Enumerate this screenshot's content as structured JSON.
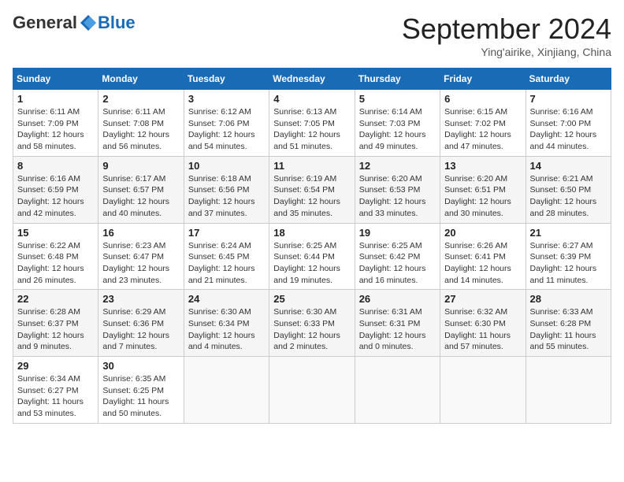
{
  "header": {
    "logo_general": "General",
    "logo_blue": "Blue",
    "month_title": "September 2024",
    "subtitle": "Ying'airike, Xinjiang, China"
  },
  "weekdays": [
    "Sunday",
    "Monday",
    "Tuesday",
    "Wednesday",
    "Thursday",
    "Friday",
    "Saturday"
  ],
  "weeks": [
    [
      {
        "day": "1",
        "sunrise": "6:11 AM",
        "sunset": "7:09 PM",
        "daylight": "12 hours and 58 minutes."
      },
      {
        "day": "2",
        "sunrise": "6:11 AM",
        "sunset": "7:08 PM",
        "daylight": "12 hours and 56 minutes."
      },
      {
        "day": "3",
        "sunrise": "6:12 AM",
        "sunset": "7:06 PM",
        "daylight": "12 hours and 54 minutes."
      },
      {
        "day": "4",
        "sunrise": "6:13 AM",
        "sunset": "7:05 PM",
        "daylight": "12 hours and 51 minutes."
      },
      {
        "day": "5",
        "sunrise": "6:14 AM",
        "sunset": "7:03 PM",
        "daylight": "12 hours and 49 minutes."
      },
      {
        "day": "6",
        "sunrise": "6:15 AM",
        "sunset": "7:02 PM",
        "daylight": "12 hours and 47 minutes."
      },
      {
        "day": "7",
        "sunrise": "6:16 AM",
        "sunset": "7:00 PM",
        "daylight": "12 hours and 44 minutes."
      }
    ],
    [
      {
        "day": "8",
        "sunrise": "6:16 AM",
        "sunset": "6:59 PM",
        "daylight": "12 hours and 42 minutes."
      },
      {
        "day": "9",
        "sunrise": "6:17 AM",
        "sunset": "6:57 PM",
        "daylight": "12 hours and 40 minutes."
      },
      {
        "day": "10",
        "sunrise": "6:18 AM",
        "sunset": "6:56 PM",
        "daylight": "12 hours and 37 minutes."
      },
      {
        "day": "11",
        "sunrise": "6:19 AM",
        "sunset": "6:54 PM",
        "daylight": "12 hours and 35 minutes."
      },
      {
        "day": "12",
        "sunrise": "6:20 AM",
        "sunset": "6:53 PM",
        "daylight": "12 hours and 33 minutes."
      },
      {
        "day": "13",
        "sunrise": "6:20 AM",
        "sunset": "6:51 PM",
        "daylight": "12 hours and 30 minutes."
      },
      {
        "day": "14",
        "sunrise": "6:21 AM",
        "sunset": "6:50 PM",
        "daylight": "12 hours and 28 minutes."
      }
    ],
    [
      {
        "day": "15",
        "sunrise": "6:22 AM",
        "sunset": "6:48 PM",
        "daylight": "12 hours and 26 minutes."
      },
      {
        "day": "16",
        "sunrise": "6:23 AM",
        "sunset": "6:47 PM",
        "daylight": "12 hours and 23 minutes."
      },
      {
        "day": "17",
        "sunrise": "6:24 AM",
        "sunset": "6:45 PM",
        "daylight": "12 hours and 21 minutes."
      },
      {
        "day": "18",
        "sunrise": "6:25 AM",
        "sunset": "6:44 PM",
        "daylight": "12 hours and 19 minutes."
      },
      {
        "day": "19",
        "sunrise": "6:25 AM",
        "sunset": "6:42 PM",
        "daylight": "12 hours and 16 minutes."
      },
      {
        "day": "20",
        "sunrise": "6:26 AM",
        "sunset": "6:41 PM",
        "daylight": "12 hours and 14 minutes."
      },
      {
        "day": "21",
        "sunrise": "6:27 AM",
        "sunset": "6:39 PM",
        "daylight": "12 hours and 11 minutes."
      }
    ],
    [
      {
        "day": "22",
        "sunrise": "6:28 AM",
        "sunset": "6:37 PM",
        "daylight": "12 hours and 9 minutes."
      },
      {
        "day": "23",
        "sunrise": "6:29 AM",
        "sunset": "6:36 PM",
        "daylight": "12 hours and 7 minutes."
      },
      {
        "day": "24",
        "sunrise": "6:30 AM",
        "sunset": "6:34 PM",
        "daylight": "12 hours and 4 minutes."
      },
      {
        "day": "25",
        "sunrise": "6:30 AM",
        "sunset": "6:33 PM",
        "daylight": "12 hours and 2 minutes."
      },
      {
        "day": "26",
        "sunrise": "6:31 AM",
        "sunset": "6:31 PM",
        "daylight": "12 hours and 0 minutes."
      },
      {
        "day": "27",
        "sunrise": "6:32 AM",
        "sunset": "6:30 PM",
        "daylight": "11 hours and 57 minutes."
      },
      {
        "day": "28",
        "sunrise": "6:33 AM",
        "sunset": "6:28 PM",
        "daylight": "11 hours and 55 minutes."
      }
    ],
    [
      {
        "day": "29",
        "sunrise": "6:34 AM",
        "sunset": "6:27 PM",
        "daylight": "11 hours and 53 minutes."
      },
      {
        "day": "30",
        "sunrise": "6:35 AM",
        "sunset": "6:25 PM",
        "daylight": "11 hours and 50 minutes."
      },
      null,
      null,
      null,
      null,
      null
    ]
  ]
}
